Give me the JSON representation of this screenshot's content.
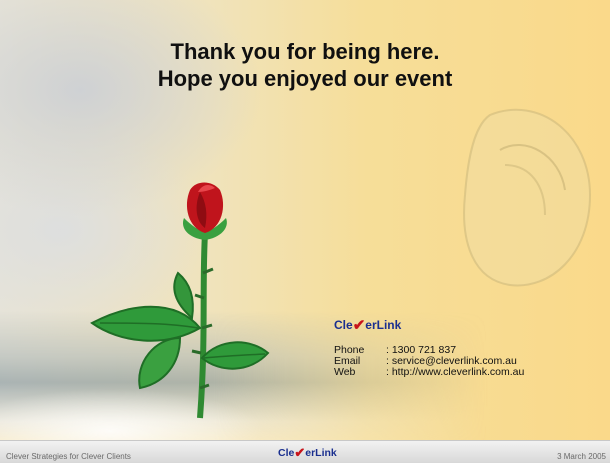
{
  "slide": {
    "title_line1": "Thank you for being here.",
    "title_line2": "Hope you enjoyed our event"
  },
  "contact": {
    "logo_part1": "Cle",
    "logo_check": "✔",
    "logo_part2": "erLink",
    "phone_label": "Phone",
    "phone_value": ": 1300 721 837",
    "email_label": "Email",
    "email_value": ": service@cleverlink.com.au",
    "web_label": "Web",
    "web_value": ": http://www.cleverlink.com.au"
  },
  "footer": {
    "left_text": "Clever Strategies for Clever Clients",
    "logo_part1": "Cle",
    "logo_check": "✔",
    "logo_part2": "erLink",
    "date": "3 March 2005"
  },
  "colors": {
    "accent": "#1a2f8f",
    "check": "#c8141b",
    "rose_red": "#c0141c",
    "leaf_green": "#2f9a3a"
  }
}
